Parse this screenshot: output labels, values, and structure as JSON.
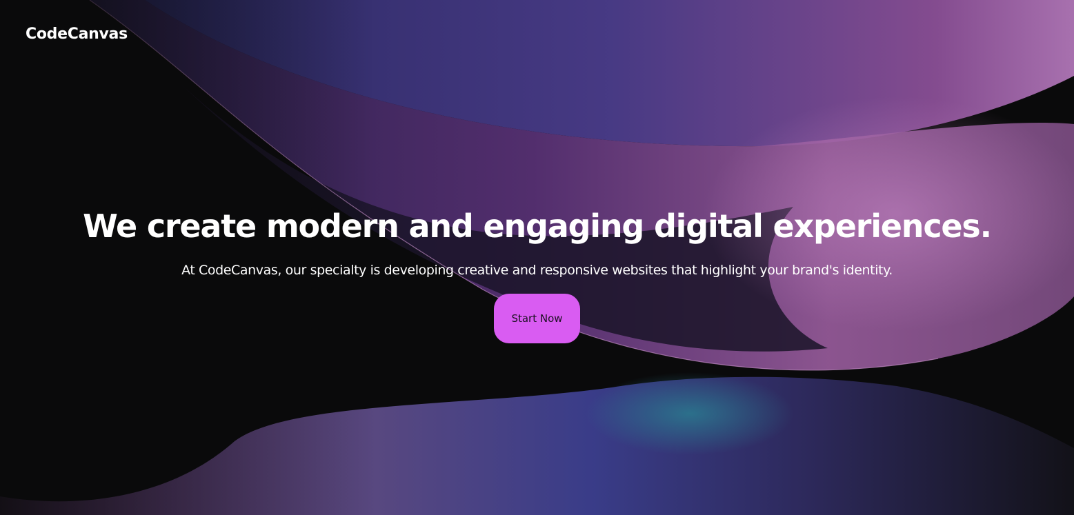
{
  "brand": {
    "name": "CodeCanvas"
  },
  "hero": {
    "headline": "We create modern and engaging digital experiences.",
    "subtext": "At CodeCanvas, our specialty is developing creative and responsive websites that highlight your brand's identity.",
    "cta_label": "Start Now"
  },
  "colors": {
    "background": "#0a0a0b",
    "accent": "#d95cf2",
    "wave_purple": "#8a4f96",
    "wave_blue": "#3c3f8f",
    "wave_teal": "#2a7f91"
  }
}
